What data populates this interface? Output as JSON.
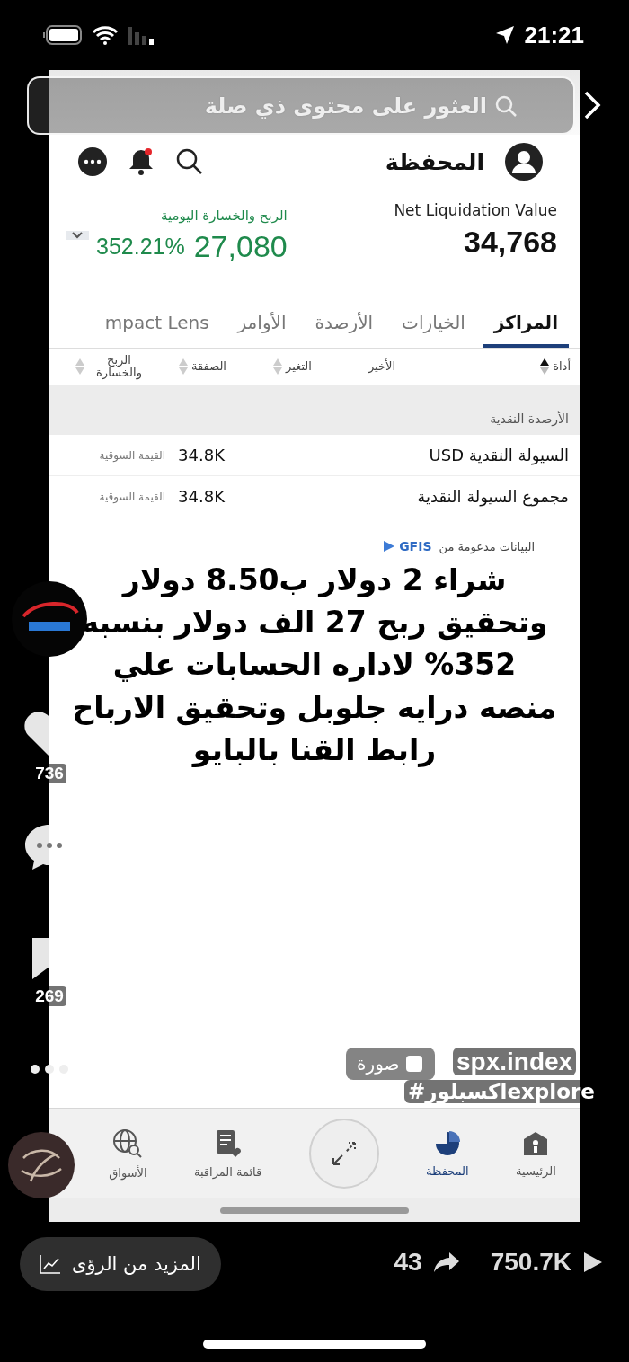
{
  "status_bar": {
    "time": "21:21"
  },
  "search": {
    "placeholder": "العثور على محتوى ذي صلة"
  },
  "app": {
    "header": {
      "title": "المحفظة",
      "unread": true
    },
    "summary": {
      "expanded": false,
      "net_label": "Net Liquidation Value",
      "net_value": "34,768",
      "pnl_label": "الربح والخسارة اليومية",
      "pnl_value": "27,080",
      "pnl_percent": "352.21%"
    },
    "tabs": [
      {
        "label": "المراكز",
        "selected": true
      },
      {
        "label": "الخيارات",
        "selected": false
      },
      {
        "label": "الأرصدة",
        "selected": false
      },
      {
        "label": "الأوامر",
        "selected": false
      },
      {
        "label": "mpact Lens",
        "selected": false
      }
    ],
    "columns": [
      {
        "label": "أداة",
        "sortable": true,
        "sorted": true
      },
      {
        "label": "الأخير",
        "sortable": false
      },
      {
        "label": "التغير",
        "sortable": true,
        "sorted": false
      },
      {
        "label": "الصفقة",
        "sortable": true,
        "sorted": false
      },
      {
        "label": "الربح والخسارة",
        "sortable": true,
        "sorted": false
      }
    ],
    "group": {
      "title": "الأرصدة النقدية",
      "rows": [
        {
          "name": "السيولة النقدية USD",
          "value": "34.8K",
          "label": "القيمة السوقية"
        },
        {
          "name": "مجموع السيولة النقدية",
          "value": "34.8K",
          "label": "القيمة السوقية"
        }
      ]
    },
    "data_source": "البيانات مدعومة من",
    "provider": "GFIS",
    "caption": "شراء 2 دولار ب8.50 دولار وتحقيق ربح 27 الف دولار بنسبه 352% لاداره الحسابات علي منصه درايه جلوبل وتحقيق الارباح رابط القنا بالبايو",
    "nav": [
      {
        "label": "الرئيسية",
        "selected": false
      },
      {
        "label": "المحفظة",
        "selected": true
      },
      {
        "label": "قائمة المراقبة",
        "selected": false
      },
      {
        "label": "الأسواق",
        "selected": false
      }
    ]
  },
  "video": {
    "likes": "736",
    "saves": "269",
    "badge": "صورة",
    "username": "spx.index",
    "hashtag": "#اكسبلورexplore",
    "insights_button": "المزيد من الرؤى",
    "shares": "43",
    "views": "750.7K"
  }
}
